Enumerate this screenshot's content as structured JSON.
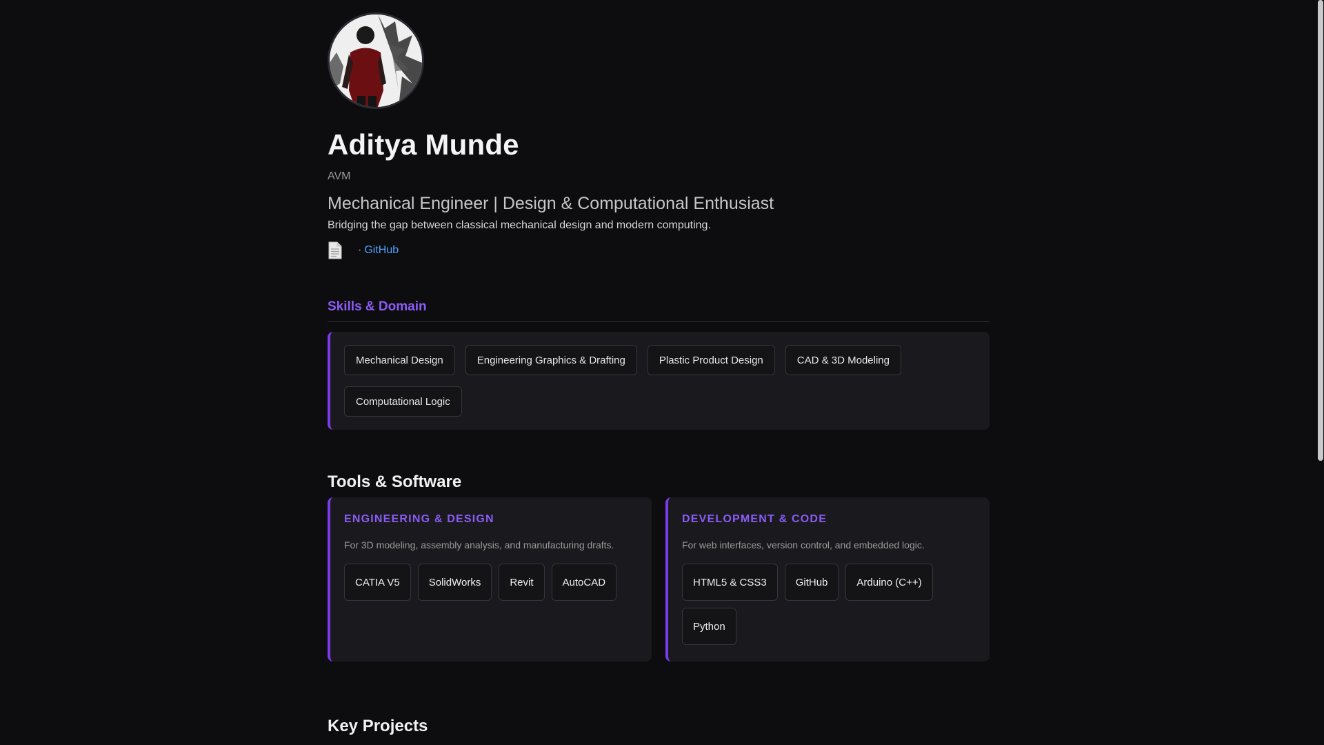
{
  "profile": {
    "name": "Aditya Munde",
    "nickname": "AVM",
    "headline": "Mechanical Engineer | Design & Computational Enthusiast",
    "tagline": "Bridging the gap between classical mechanical design and modern computing.",
    "avatar_icon": "profile-photo",
    "links": {
      "resume_icon": "document-icon",
      "separator": "·",
      "github_label": "GitHub"
    }
  },
  "skills": {
    "title": "Skills & Domain",
    "items": [
      "Mechanical Design",
      "Engineering Graphics & Drafting",
      "Plastic Product Design",
      "CAD & 3D Modeling",
      "Computational Logic"
    ]
  },
  "tools": {
    "title": "Tools & Software",
    "groups": [
      {
        "title": "ENGINEERING & DESIGN",
        "description": "For 3D modeling, assembly analysis, and manufacturing drafts.",
        "items": [
          "CATIA V5",
          "SolidWorks",
          "Revit",
          "AutoCAD"
        ]
      },
      {
        "title": "DEVELOPMENT & CODE",
        "description": "For web interfaces, version control, and embedded logic.",
        "items": [
          "HTML5 & CSS3",
          "GitHub",
          "Arduino (C++)",
          "Python"
        ]
      }
    ]
  },
  "projects": {
    "title": "Key Projects"
  },
  "colors": {
    "background": "#0d0d0f",
    "accent": "#8b5cf6",
    "link": "#4da3ff",
    "card": "#1a1a1e"
  }
}
